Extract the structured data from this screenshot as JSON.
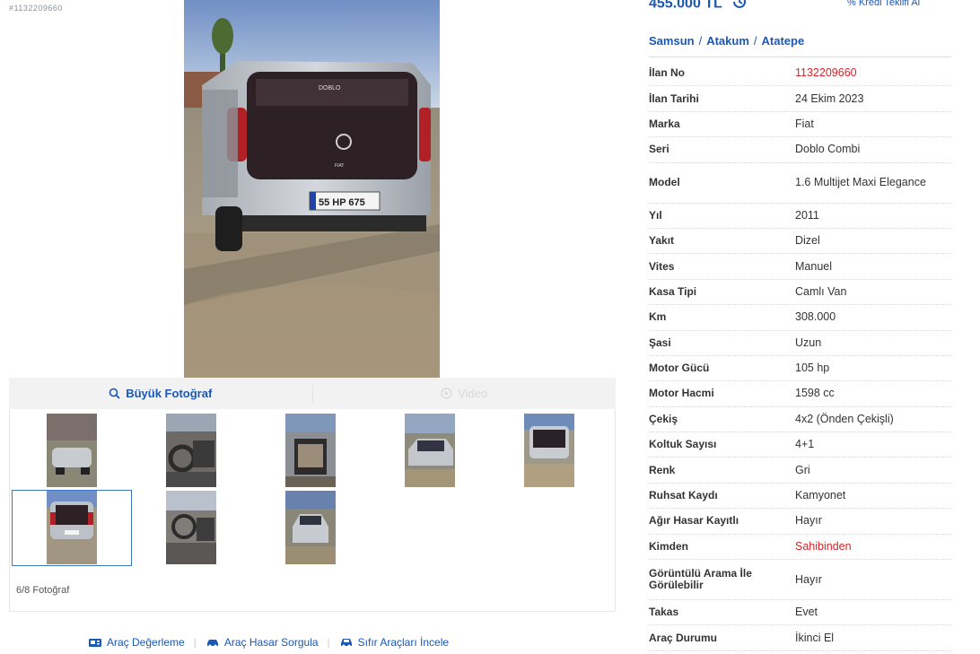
{
  "listing_id_small": "#1132209660",
  "price": {
    "text": "455.000 TL",
    "icon": "price-history-icon"
  },
  "credit_link": "Kredi Teklifi Al",
  "location": {
    "city": "Samsun",
    "district": "Atakum",
    "neighborhood": "Atatepe"
  },
  "photo_tabs": {
    "large_photo": "Büyük Fotoğraf",
    "video": "Video"
  },
  "photo_counter": "6/8 Fotoğraf",
  "bottom_links": {
    "valuation": "Araç Değerleme",
    "damage_query": "Araç Hasar Sorgula",
    "new_cars": "Sıfır Araçları İncele"
  },
  "colors": {
    "accent": "#1b57b5",
    "red": "#d8232a"
  },
  "specs": [
    {
      "label": "İlan No",
      "value": "1132209660"
    },
    {
      "label": "İlan Tarihi",
      "value": "24 Ekim 2023"
    },
    {
      "label": "Marka",
      "value": "Fiat"
    },
    {
      "label": "Seri",
      "value": "Doblo Combi"
    },
    {
      "label": "Model",
      "value": "1.6 Multijet Maxi Elegance"
    },
    {
      "label": "Yıl",
      "value": "2011"
    },
    {
      "label": "Yakıt",
      "value": "Dizel"
    },
    {
      "label": "Vites",
      "value": "Manuel"
    },
    {
      "label": "Kasa Tipi",
      "value": "Camlı Van"
    },
    {
      "label": "Km",
      "value": "308.000"
    },
    {
      "label": "Şasi",
      "value": "Uzun"
    },
    {
      "label": "Motor Gücü",
      "value": "105 hp"
    },
    {
      "label": "Motor Hacmi",
      "value": "1598 cc"
    },
    {
      "label": "Çekiş",
      "value": "4x2 (Önden Çekişli)"
    },
    {
      "label": "Koltuk Sayısı",
      "value": "4+1"
    },
    {
      "label": "Renk",
      "value": "Gri"
    },
    {
      "label": "Ruhsat Kaydı",
      "value": "Kamyonet"
    },
    {
      "label": "Ağır Hasar Kayıtlı",
      "value": "Hayır"
    },
    {
      "label": "Kimden",
      "value": "Sahibinden"
    },
    {
      "label": "Görüntülü Arama İle Görülebilir",
      "value": "Hayır"
    },
    {
      "label": "Takas",
      "value": "Evet"
    },
    {
      "label": "Araç Durumu",
      "value": "İkinci El"
    }
  ],
  "main_photo": {
    "plate": "55 HP 675",
    "badge": "DOBLO",
    "brand": "FIAT"
  }
}
